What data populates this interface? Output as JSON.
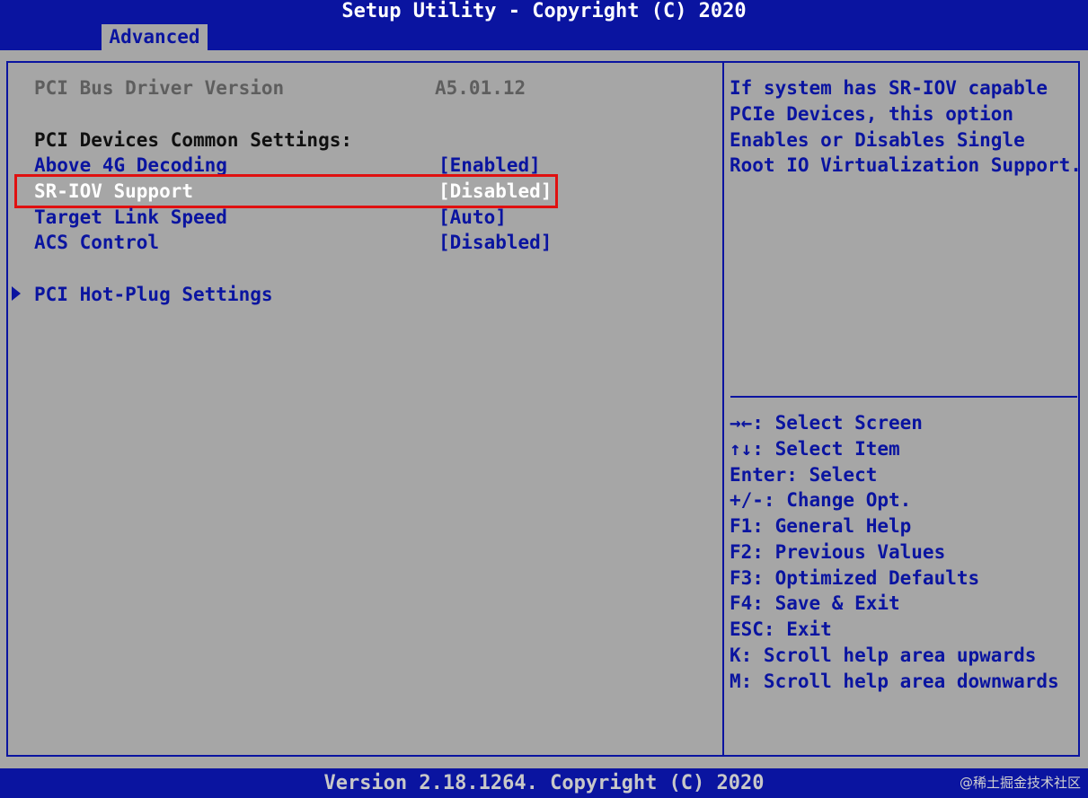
{
  "header": {
    "title": "Setup Utility - Copyright (C) 2020",
    "tab": "Advanced"
  },
  "main": {
    "driver_label": "PCI Bus Driver Version",
    "driver_value": "A5.01.12",
    "section_heading": "PCI Devices Common Settings:",
    "items": [
      {
        "label": "Above 4G Decoding",
        "value": "[Enabled]"
      },
      {
        "label": "SR-IOV Support",
        "value": "[Disabled]"
      },
      {
        "label": "Target Link Speed",
        "value": "[Auto]"
      },
      {
        "label": "ACS Control",
        "value": "[Disabled]"
      }
    ],
    "submenu": "PCI Hot-Plug Settings"
  },
  "help": {
    "lines": [
      "If system has SR-IOV capable",
      "PCIe Devices, this option",
      "Enables or Disables Single",
      "Root IO Virtualization Support."
    ]
  },
  "keys": [
    "→←: Select Screen",
    "↑↓: Select Item",
    "Enter: Select",
    "+/-: Change Opt.",
    "F1: General Help",
    "F2: Previous Values",
    "F3: Optimized Defaults",
    "F4: Save & Exit",
    "ESC: Exit",
    "K: Scroll help area upwards",
    "M: Scroll help area downwards"
  ],
  "footer": {
    "version": "Version 2.18.1264. Copyright (C) 2020",
    "watermark": "@稀土掘金技术社区"
  },
  "colors": {
    "background": "#a6a6a6",
    "bar_blue": "#0a14a0",
    "selected_text": "#ffffff",
    "highlight_border": "#e01010"
  }
}
